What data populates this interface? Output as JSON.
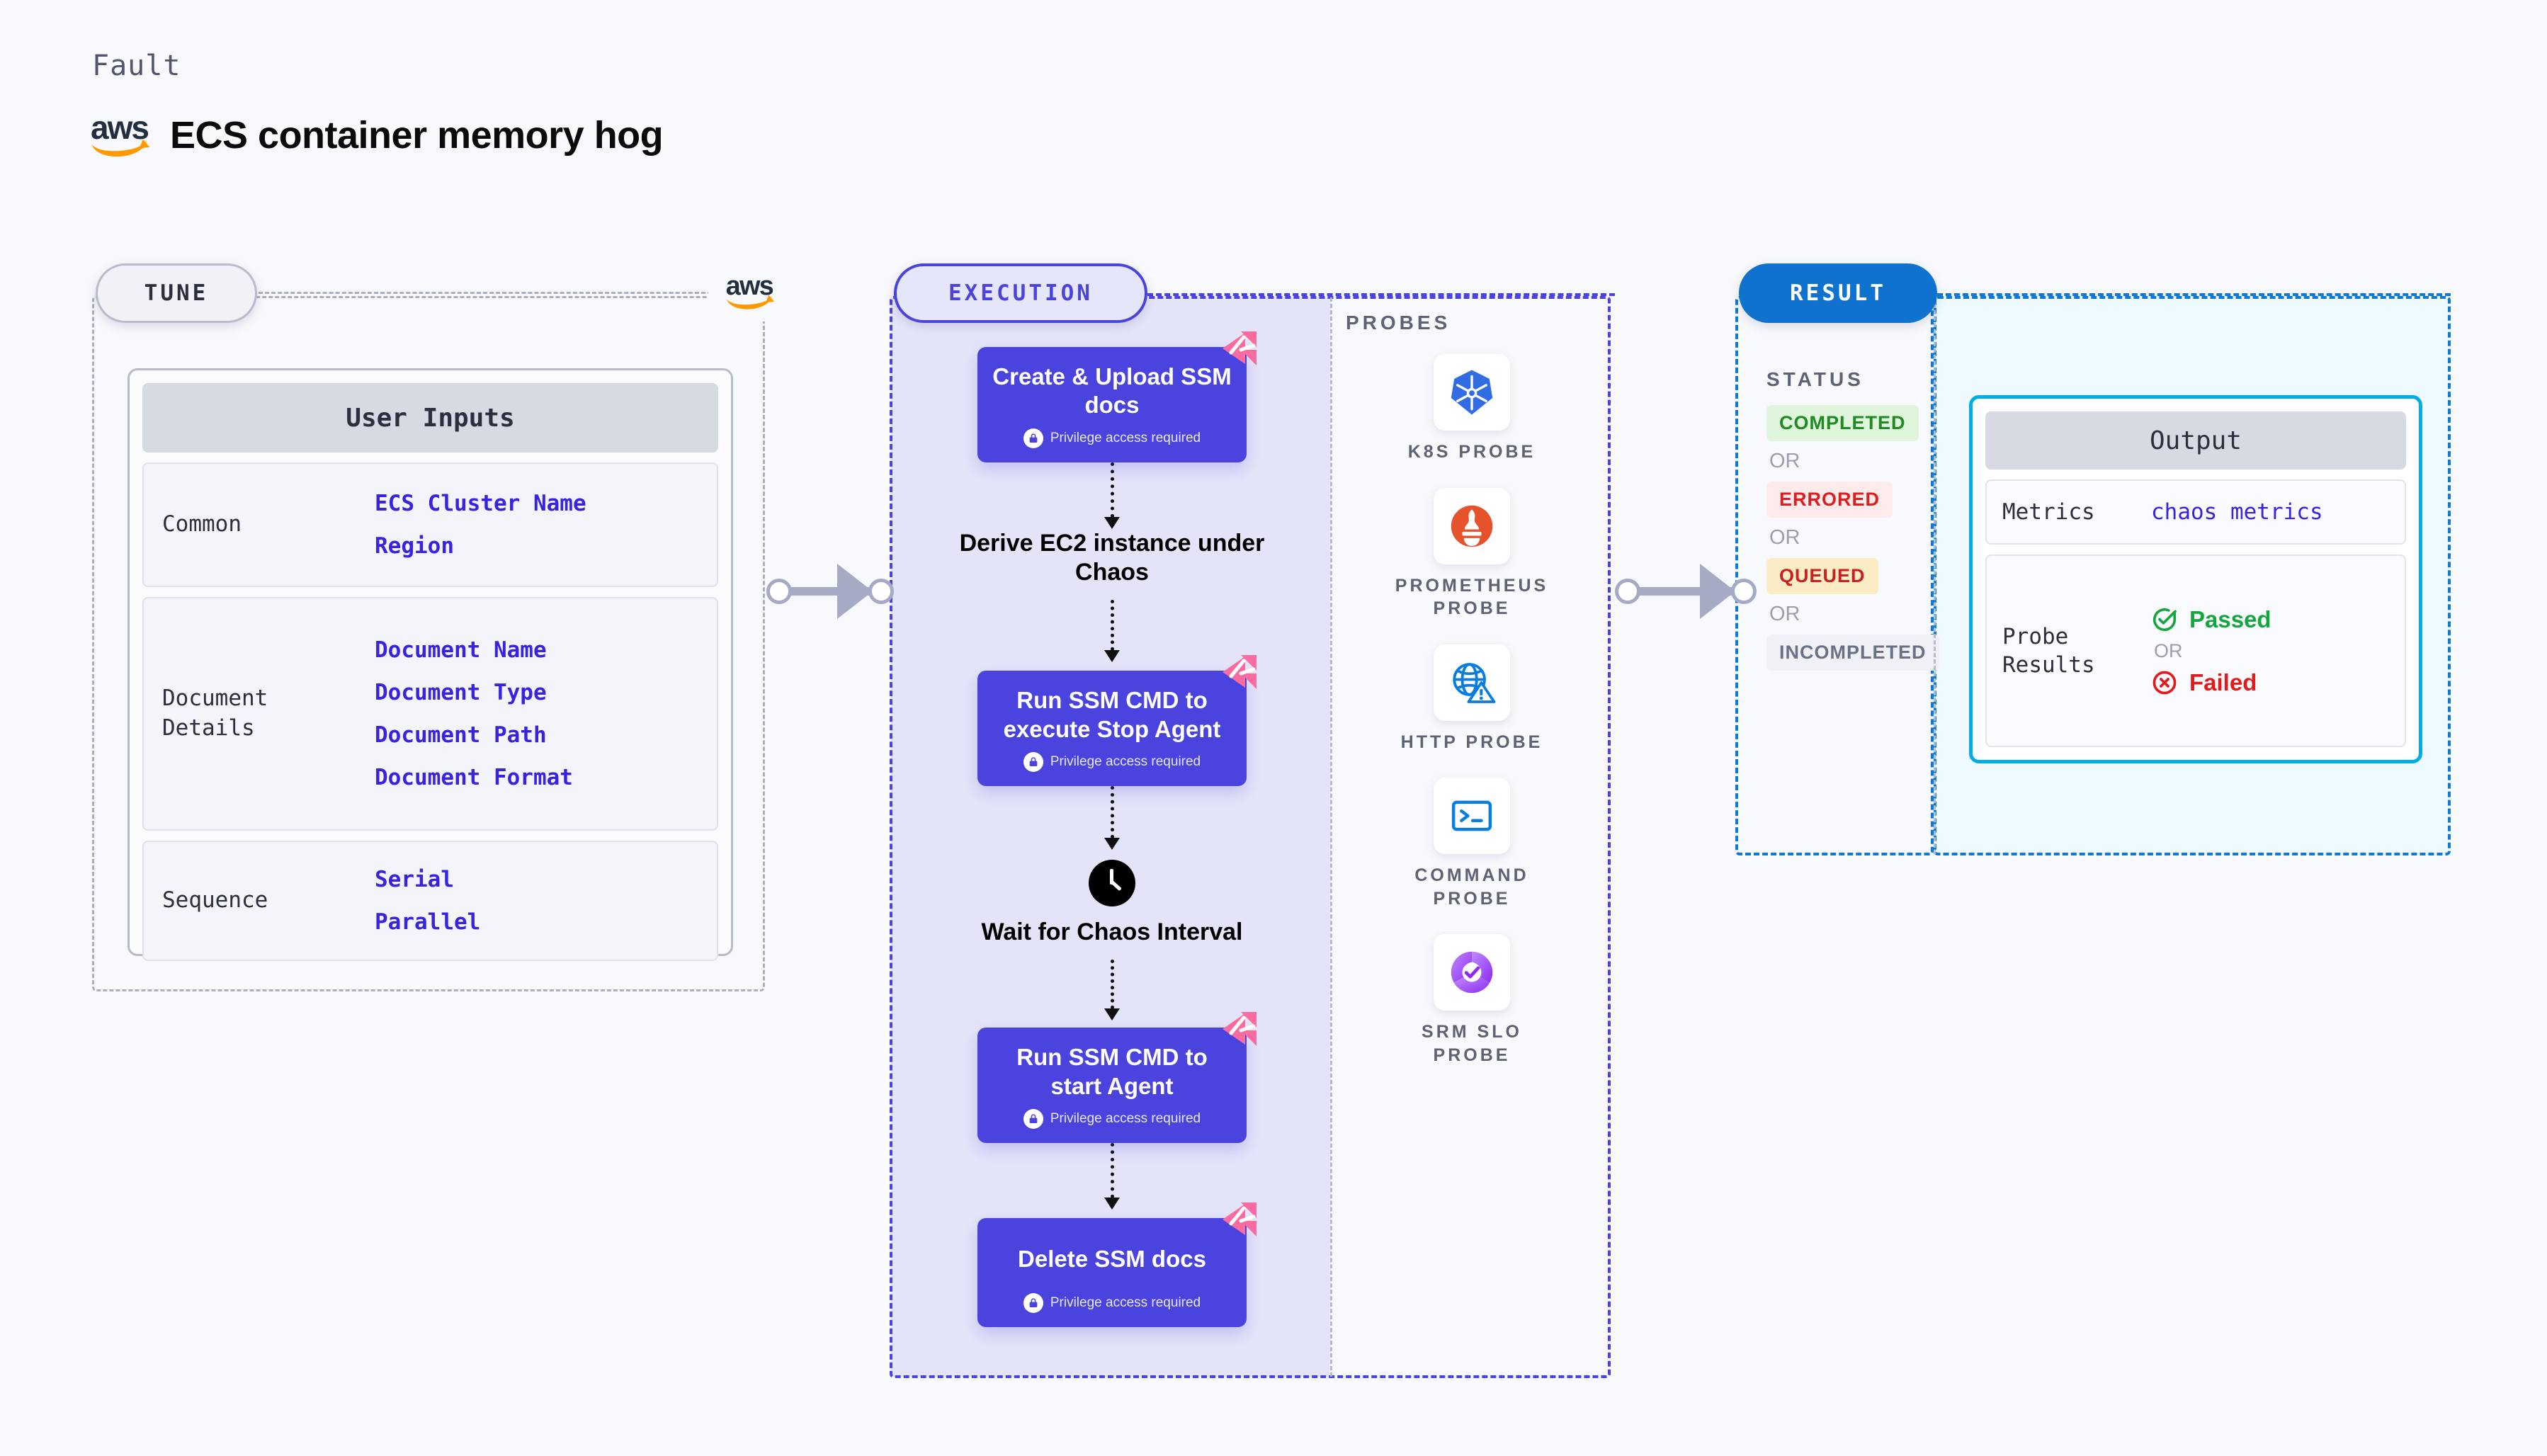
{
  "header": {
    "kind_label": "Fault",
    "logo": "aws-logo",
    "title": "ECS container memory hog"
  },
  "tune": {
    "badge": "TUNE",
    "card_title": "User Inputs",
    "rows": [
      {
        "key": "Common",
        "values": [
          "ECS Cluster Name",
          "Region"
        ]
      },
      {
        "key": "Document\nDetails",
        "values": [
          "Document Name",
          "Document Type",
          "Document Path",
          "Document Format"
        ]
      },
      {
        "key": "Sequence",
        "values": [
          "Serial",
          "Parallel"
        ]
      }
    ]
  },
  "execution": {
    "badge": "EXECUTION",
    "privilege_note": "Privilege access required",
    "steps": [
      {
        "type": "node",
        "label": "Create & Upload SSM docs",
        "privileged": true,
        "chaos_badge": true
      },
      {
        "type": "plain",
        "label": "Derive EC2 instance under Chaos",
        "privileged": false,
        "chaos_badge": false
      },
      {
        "type": "node",
        "label": "Run SSM CMD to execute Stop Agent",
        "privileged": true,
        "chaos_badge": true
      },
      {
        "type": "clock",
        "label": "Wait for Chaos Interval",
        "privileged": false,
        "chaos_badge": false
      },
      {
        "type": "node",
        "label": "Run SSM CMD to start Agent",
        "privileged": true,
        "chaos_badge": true
      },
      {
        "type": "node",
        "label": "Delete SSM docs",
        "privileged": true,
        "chaos_badge": true
      }
    ]
  },
  "probes": {
    "label": "PROBES",
    "items": [
      {
        "name": "K8S PROBE",
        "icon": "kubernetes-icon"
      },
      {
        "name": "PROMETHEUS PROBE",
        "icon": "prometheus-icon"
      },
      {
        "name": "HTTP PROBE",
        "icon": "globe-warning-icon"
      },
      {
        "name": "COMMAND PROBE",
        "icon": "terminal-icon"
      },
      {
        "name": "SRM SLO PROBE",
        "icon": "slo-donut-check-icon"
      }
    ]
  },
  "result": {
    "badge": "RESULT",
    "status_label": "STATUS",
    "or_text": "OR",
    "statuses": [
      {
        "label": "COMPLETED",
        "color": "#1f8c23",
        "bg": "#dff5dc"
      },
      {
        "label": "ERRORED",
        "color": "#d91f1f",
        "bg": "#fdeaea"
      },
      {
        "label": "QUEUED",
        "color": "#cc1f1f",
        "bg": "#fbecc4"
      },
      {
        "label": "INCOMPLETED",
        "color": "#6b7185",
        "bg": "#f0f1f6"
      }
    ],
    "output": {
      "title": "Output",
      "metrics_key": "Metrics",
      "metrics_value": "chaos metrics",
      "probe_results_key": "Probe Results",
      "passed_label": "Passed",
      "failed_label": "Failed",
      "or_text": "OR"
    }
  },
  "colors": {
    "node_blue": "#4a43dd",
    "chaos_pink": "#fa6ba0",
    "result_blue": "#0f72cf",
    "output_border": "#00ade4",
    "tune_gray": "#a9b0c2",
    "value_indigo": "#3723e0"
  }
}
